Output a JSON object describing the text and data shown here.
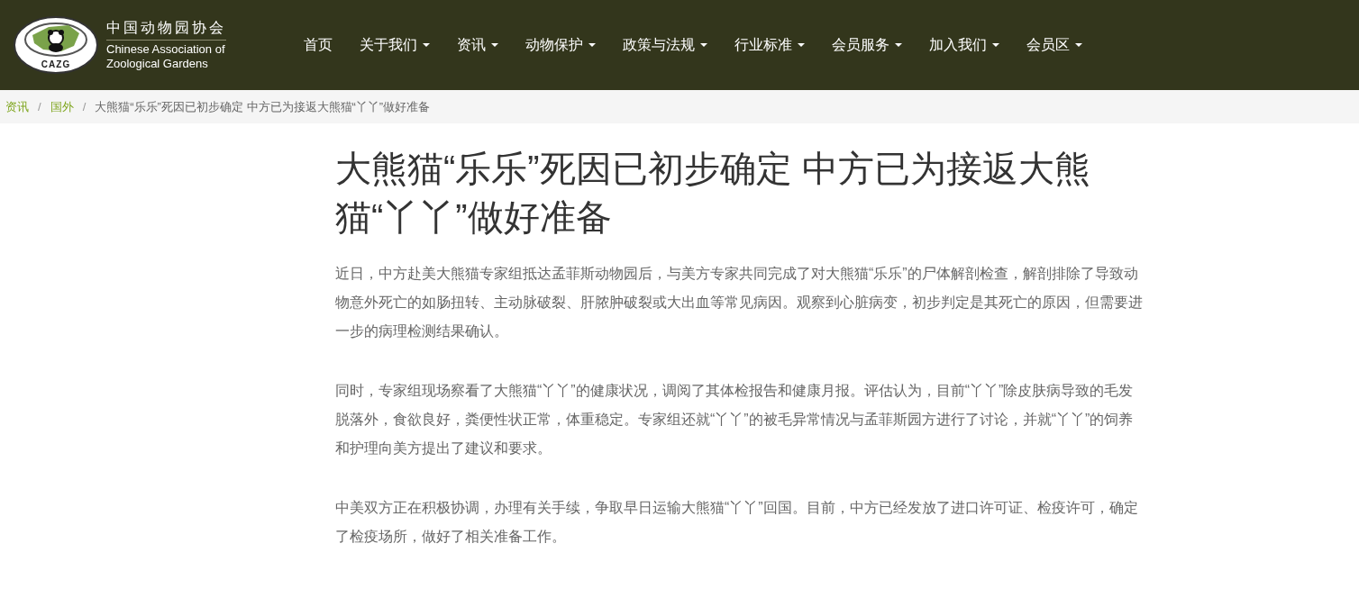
{
  "logo": {
    "emblem_text": "CAZG",
    "name_zh": "中国动物园协会",
    "name_en": [
      "Chinese Association of",
      "Zoological Gardens"
    ]
  },
  "nav": [
    {
      "label": "首页",
      "dropdown": false
    },
    {
      "label": "关于我们",
      "dropdown": true
    },
    {
      "label": "资讯",
      "dropdown": true
    },
    {
      "label": "动物保护",
      "dropdown": true
    },
    {
      "label": "政策与法规",
      "dropdown": true
    },
    {
      "label": "行业标准",
      "dropdown": true
    },
    {
      "label": "会员服务",
      "dropdown": true
    },
    {
      "label": "加入我们",
      "dropdown": true
    },
    {
      "label": "会员区",
      "dropdown": true
    }
  ],
  "breadcrumb": [
    {
      "label": "资讯",
      "current": false
    },
    {
      "separator": "/",
      "label": "国外",
      "current": false
    },
    {
      "separator": "/",
      "label": "大熊猫“乐乐”死因已初步确定 中方已为接返大熊猫“丫丫”做好准备",
      "current": true
    }
  ],
  "article": {
    "title": "大熊猫“乐乐”死因已初步确定 中方已为接返大熊猫“丫丫”做好准备",
    "paragraphs": [
      "近日，中方赴美大熊猫专家组抵达孟菲斯动物园后，与美方专家共同完成了对大熊猫“乐乐”的尸体解剖检查，解剖排除了导致动物意外死亡的如肠扭转、主动脉破裂、肝脓肿破裂或大出血等常见病因。观察到心脏病变，初步判定是其死亡的原因，但需要进一步的病理检测结果确认。",
      "同时，专家组现场察看了大熊猫“丫丫”的健康状况，调阅了其体检报告和健康月报。评估认为，目前“丫丫”除皮肤病导致的毛发脱落外，食欲良好，粪便性状正常，体重稳定。专家组还就“丫丫”的被毛异常情况与孟菲斯园方进行了讨论，并就“丫丫”的饲养和护理向美方提出了建议和要求。",
      "中美双方正在积极协调，办理有关手续，争取早日运输大熊猫“丫丫”回国。目前，中方已经发放了进口许可证、检疫许可，确定了检疫场所，做好了相关准备工作。"
    ]
  }
}
